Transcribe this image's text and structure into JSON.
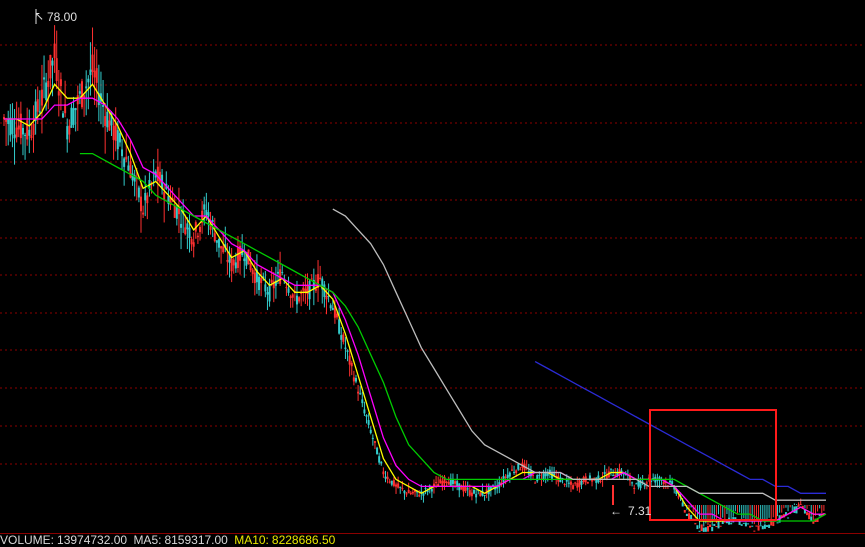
{
  "status_bar": {
    "volume_label": "VOLUME:",
    "volume_value": "13974732.00",
    "ma5_label": "MA5:",
    "ma5_value": "8159317.00",
    "ma10_label": "MA10:",
    "ma10_value": "8228686.50"
  },
  "annotations": {
    "high_label": "78.00",
    "low_label": "7.31"
  },
  "colors": {
    "background": "#000000",
    "grid": "#8b0000",
    "candle_up": "#ff3030",
    "candle_down": "#33cccc",
    "ma_white": "#c8c8c8",
    "ma_yellow": "#ffff00",
    "ma_magenta": "#ff00ff",
    "ma_green": "#00cc00",
    "ma_gray": "#bdbdbd",
    "ma_blue": "#2b2bd6",
    "highlight_box": "#ff1a1a"
  },
  "chart_data": {
    "type": "candlestick",
    "high": 78.0,
    "low": 7.31,
    "grid": true,
    "series": [
      {
        "name": "price",
        "color": "#c8c8c8",
        "values": [
          63,
          62,
          61,
          66,
          72,
          62,
          66,
          70,
          64,
          60,
          56,
          50,
          55,
          52,
          49,
          46,
          50,
          45,
          42,
          44,
          40,
          38,
          41,
          37,
          38,
          40,
          36,
          30,
          24,
          18,
          12,
          10,
          9,
          9,
          10,
          11,
          10,
          9,
          9,
          10,
          12,
          13,
          11,
          12,
          11,
          10,
          11,
          11,
          12,
          12,
          10,
          11,
          11,
          10,
          6,
          4,
          4,
          5,
          5,
          4,
          4,
          5,
          6,
          7,
          5,
          6
        ]
      },
      {
        "name": "",
        "color": "#ffff00",
        "values": [
          63,
          63,
          62,
          64,
          68,
          66,
          66,
          68,
          65,
          62,
          58,
          53,
          54,
          52,
          50,
          47,
          49,
          46,
          43,
          44,
          41,
          39,
          40,
          38,
          38,
          39,
          37,
          32,
          26,
          20,
          14,
          11,
          10,
          9,
          10,
          10,
          10,
          10,
          9,
          10,
          11,
          12,
          12,
          12,
          11,
          11,
          11,
          11,
          12,
          12,
          11,
          11,
          11,
          10,
          7,
          5,
          5,
          5,
          5,
          5,
          5,
          5,
          6,
          7,
          6,
          6
        ]
      },
      {
        "name": "",
        "color": "#ff00ff",
        "values": [
          63,
          63,
          63,
          63,
          65,
          65,
          66,
          66,
          65,
          63,
          60,
          56,
          55,
          53,
          51,
          49,
          49,
          47,
          45,
          44,
          42,
          41,
          40,
          39,
          39,
          39,
          38,
          34,
          29,
          23,
          17,
          13,
          11,
          10,
          10,
          10,
          10,
          10,
          10,
          10,
          11,
          11,
          12,
          12,
          12,
          11,
          11,
          11,
          11,
          12,
          11,
          11,
          11,
          10,
          8,
          6,
          6,
          5,
          5,
          5,
          5,
          5,
          6,
          7,
          6,
          6
        ]
      },
      {
        "name": "",
        "color": "#00cc00",
        "values": [
          null,
          null,
          null,
          null,
          null,
          null,
          58,
          58,
          57,
          56,
          55,
          54,
          52,
          51,
          50,
          49,
          48,
          47,
          46,
          45,
          44,
          43,
          42,
          41,
          40,
          39,
          38,
          36,
          33,
          29,
          25,
          20,
          16,
          14,
          12,
          11,
          11,
          11,
          11,
          11,
          11,
          11,
          11,
          11,
          11,
          11,
          11,
          11,
          11,
          11,
          11,
          11,
          11,
          11,
          10,
          9,
          8,
          7,
          6,
          6,
          5,
          5,
          5,
          5,
          5,
          6
        ]
      },
      {
        "name": "",
        "color": "#bdbdbd",
        "values": [
          null,
          null,
          null,
          null,
          null,
          null,
          null,
          null,
          null,
          null,
          null,
          null,
          null,
          null,
          null,
          null,
          null,
          null,
          null,
          null,
          null,
          null,
          null,
          null,
          null,
          null,
          50,
          49,
          47,
          45,
          42,
          38,
          34,
          30,
          27,
          24,
          21,
          18,
          16,
          15,
          14,
          13,
          12,
          12,
          12,
          11,
          11,
          11,
          11,
          11,
          11,
          10,
          10,
          10,
          10,
          9,
          9,
          9,
          9,
          9,
          9,
          8,
          8,
          8,
          8,
          8
        ]
      },
      {
        "name": "",
        "color": "#2b2bd6",
        "values": [
          null,
          null,
          null,
          null,
          null,
          null,
          null,
          null,
          null,
          null,
          null,
          null,
          null,
          null,
          null,
          null,
          null,
          null,
          null,
          null,
          null,
          null,
          null,
          null,
          null,
          null,
          null,
          null,
          null,
          null,
          null,
          null,
          null,
          null,
          null,
          null,
          null,
          null,
          null,
          null,
          null,
          null,
          28,
          27,
          26,
          25,
          24,
          23,
          22,
          21,
          20,
          19,
          18,
          17,
          16,
          15,
          14,
          13,
          12,
          11,
          11,
          10,
          10,
          9,
          9,
          9
        ]
      }
    ]
  }
}
